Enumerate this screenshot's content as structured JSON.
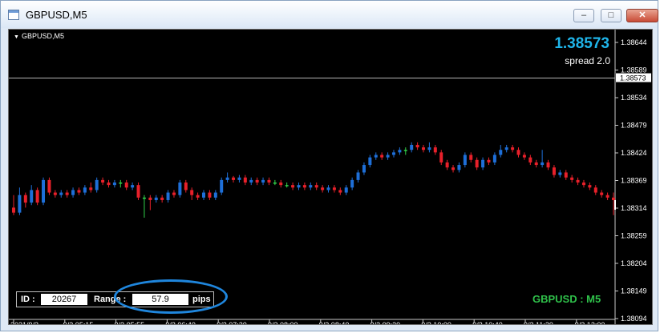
{
  "window": {
    "title": "GBPUSD,M5",
    "minimize_icon": "minimize-icon",
    "restore_icon": "restore-icon",
    "close_icon": "close-icon"
  },
  "chart": {
    "symbol_label": "GBPUSD,M5",
    "bid_price": "1.38573",
    "spread_text": "spread 2.0",
    "current_price_label": "1.38573",
    "symbol_tf_label": "GBPUSD : M5",
    "id_label": "ID :",
    "id_value": "20267",
    "range_label": "Range :",
    "range_value": "57.9",
    "pips_label": "pips",
    "colors": {
      "bull": "#1e6fd8",
      "bear": "#e8202a",
      "doji": "#32d24a",
      "axis": "#ffffff",
      "bid_line": "#b4b4b4",
      "price_text": "#1fb5ea",
      "symbol_text": "#2fc14a",
      "highlight": "#1f86dd"
    }
  },
  "chart_data": {
    "type": "candlestick",
    "y_ticks": [
      "1.38644",
      "1.38589",
      "1.38534",
      "1.38479",
      "1.38424",
      "1.38369",
      "1.38314",
      "1.38259",
      "1.38204",
      "1.38149",
      "1.38094"
    ],
    "ylim": [
      1.38094,
      1.38644
    ],
    "x_ticks": [
      "2021/9/3",
      "9/3 05:15",
      "9/3 05:55",
      "9/3 06:40",
      "9/3 07:20",
      "9/3 08:00",
      "9/3 08:40",
      "9/3 09:20",
      "9/3 10:00",
      "9/3 10:40",
      "9/3 11:20",
      "9/3 12:00"
    ],
    "current_price": 1.38573,
    "candles": [
      [
        1.38315,
        1.38305,
        1.383,
        1.3834
      ],
      [
        1.38305,
        1.3834,
        1.383,
        1.38355
      ],
      [
        1.3834,
        1.38325,
        1.38315,
        1.38345
      ],
      [
        1.38325,
        1.3835,
        1.3832,
        1.3836
      ],
      [
        1.3835,
        1.38325,
        1.3832,
        1.38355
      ],
      [
        1.38325,
        1.3837,
        1.3832,
        1.38375
      ],
      [
        1.3837,
        1.38345,
        1.3834,
        1.38375
      ],
      [
        1.38345,
        1.3834,
        1.38335,
        1.3835
      ],
      [
        1.3834,
        1.38345,
        1.38335,
        1.3835
      ],
      [
        1.38345,
        1.3834,
        1.38335,
        1.3835
      ],
      [
        1.3834,
        1.3835,
        1.38335,
        1.38355
      ],
      [
        1.3835,
        1.38345,
        1.3834,
        1.38355
      ],
      [
        1.38345,
        1.38355,
        1.3834,
        1.3836
      ],
      [
        1.38355,
        1.3835,
        1.38345,
        1.38365
      ],
      [
        1.3835,
        1.3837,
        1.38345,
        1.38375
      ],
      [
        1.3837,
        1.38365,
        1.3836,
        1.38375
      ],
      [
        1.38365,
        1.3836,
        1.38355,
        1.3837
      ],
      [
        1.3836,
        1.38365,
        1.38355,
        1.3837
      ],
      [
        1.38365,
        1.38365,
        1.38355,
        1.3837
      ],
      [
        1.38365,
        1.38355,
        1.3835,
        1.3837
      ],
      [
        1.38355,
        1.3836,
        1.3835,
        1.38365
      ],
      [
        1.3836,
        1.38335,
        1.3833,
        1.38365
      ],
      [
        1.38335,
        1.38335,
        1.38295,
        1.3834
      ],
      [
        1.38335,
        1.3833,
        1.3831,
        1.3834
      ],
      [
        1.3833,
        1.38335,
        1.38325,
        1.3834
      ],
      [
        1.38335,
        1.3833,
        1.38325,
        1.3834
      ],
      [
        1.3833,
        1.38345,
        1.38325,
        1.3835
      ],
      [
        1.38345,
        1.3834,
        1.38335,
        1.3835
      ],
      [
        1.3834,
        1.38365,
        1.38335,
        1.3837
      ],
      [
        1.38365,
        1.3835,
        1.38345,
        1.3837
      ],
      [
        1.3835,
        1.3834,
        1.3833,
        1.38355
      ],
      [
        1.3834,
        1.38335,
        1.3833,
        1.38345
      ],
      [
        1.38335,
        1.38345,
        1.3833,
        1.3835
      ],
      [
        1.38345,
        1.38335,
        1.3833,
        1.3835
      ],
      [
        1.38335,
        1.38345,
        1.3833,
        1.3835
      ],
      [
        1.38345,
        1.3837,
        1.3834,
        1.38375
      ],
      [
        1.3837,
        1.38375,
        1.38365,
        1.38385
      ],
      [
        1.38375,
        1.3837,
        1.38365,
        1.38378
      ],
      [
        1.3837,
        1.38375,
        1.38365,
        1.3838
      ],
      [
        1.38375,
        1.38365,
        1.3836,
        1.3838
      ],
      [
        1.38365,
        1.3837,
        1.3836,
        1.38375
      ],
      [
        1.3837,
        1.38365,
        1.3836,
        1.38375
      ],
      [
        1.38365,
        1.3837,
        1.3836,
        1.38375
      ],
      [
        1.3837,
        1.38365,
        1.3836,
        1.38375
      ],
      [
        1.38365,
        1.38365,
        1.3836,
        1.3837
      ],
      [
        1.38365,
        1.3836,
        1.38355,
        1.3837
      ],
      [
        1.3836,
        1.3836,
        1.38355,
        1.38365
      ],
      [
        1.3836,
        1.38355,
        1.3835,
        1.38365
      ],
      [
        1.38355,
        1.3836,
        1.3835,
        1.38365
      ],
      [
        1.3836,
        1.38355,
        1.3835,
        1.38365
      ],
      [
        1.38355,
        1.3836,
        1.3835,
        1.38365
      ],
      [
        1.3836,
        1.38355,
        1.3835,
        1.38365
      ],
      [
        1.38355,
        1.3835,
        1.38345,
        1.3836
      ],
      [
        1.3835,
        1.38355,
        1.38345,
        1.3836
      ],
      [
        1.38355,
        1.3835,
        1.38345,
        1.3836
      ],
      [
        1.3835,
        1.38345,
        1.3834,
        1.38355
      ],
      [
        1.38345,
        1.38355,
        1.3834,
        1.3836
      ],
      [
        1.38355,
        1.3837,
        1.3835,
        1.38375
      ],
      [
        1.3837,
        1.38385,
        1.38365,
        1.3839
      ],
      [
        1.38385,
        1.384,
        1.3838,
        1.38405
      ],
      [
        1.384,
        1.38415,
        1.38395,
        1.3842
      ],
      [
        1.38415,
        1.3842,
        1.3841,
        1.38425
      ],
      [
        1.3842,
        1.38415,
        1.3841,
        1.38425
      ],
      [
        1.38415,
        1.3842,
        1.3841,
        1.38425
      ],
      [
        1.3842,
        1.38425,
        1.38415,
        1.3843
      ],
      [
        1.38425,
        1.3843,
        1.3842,
        1.38435
      ],
      [
        1.3843,
        1.3843,
        1.3842,
        1.38435
      ],
      [
        1.3843,
        1.3844,
        1.38425,
        1.38445
      ],
      [
        1.3844,
        1.38435,
        1.3843,
        1.38445
      ],
      [
        1.38435,
        1.3843,
        1.38425,
        1.3844
      ],
      [
        1.3843,
        1.38435,
        1.38425,
        1.38445
      ],
      [
        1.38435,
        1.38425,
        1.3842,
        1.3844
      ],
      [
        1.38425,
        1.38405,
        1.384,
        1.3843
      ],
      [
        1.38405,
        1.38395,
        1.3839,
        1.3841
      ],
      [
        1.38395,
        1.3839,
        1.38385,
        1.384
      ],
      [
        1.3839,
        1.384,
        1.38385,
        1.38405
      ],
      [
        1.384,
        1.3842,
        1.38395,
        1.38425
      ],
      [
        1.3842,
        1.3841,
        1.38405,
        1.38425
      ],
      [
        1.3841,
        1.38395,
        1.3839,
        1.38415
      ],
      [
        1.38395,
        1.3841,
        1.3839,
        1.38415
      ],
      [
        1.3841,
        1.38405,
        1.384,
        1.38415
      ],
      [
        1.38405,
        1.3842,
        1.384,
        1.38425
      ],
      [
        1.3842,
        1.3843,
        1.38415,
        1.3844
      ],
      [
        1.3843,
        1.38435,
        1.38425,
        1.3844
      ],
      [
        1.38435,
        1.3843,
        1.38425,
        1.3844
      ],
      [
        1.3843,
        1.3842,
        1.38415,
        1.38435
      ],
      [
        1.3842,
        1.38415,
        1.3841,
        1.38425
      ],
      [
        1.38415,
        1.38405,
        1.384,
        1.3842
      ],
      [
        1.38405,
        1.384,
        1.38395,
        1.3841
      ],
      [
        1.384,
        1.38405,
        1.38395,
        1.3843
      ],
      [
        1.38405,
        1.38395,
        1.3839,
        1.3841
      ],
      [
        1.38395,
        1.3838,
        1.38375,
        1.384
      ],
      [
        1.3838,
        1.38385,
        1.38375,
        1.3839
      ],
      [
        1.38385,
        1.38375,
        1.3837,
        1.3839
      ],
      [
        1.38375,
        1.3837,
        1.38365,
        1.3838
      ],
      [
        1.3837,
        1.38365,
        1.3836,
        1.38375
      ],
      [
        1.38365,
        1.3836,
        1.38355,
        1.3837
      ],
      [
        1.3836,
        1.38355,
        1.3835,
        1.38365
      ],
      [
        1.38355,
        1.38345,
        1.3834,
        1.3836
      ],
      [
        1.38345,
        1.3834,
        1.38335,
        1.3835
      ],
      [
        1.3834,
        1.38335,
        1.3833,
        1.38345
      ],
      [
        1.38335,
        1.3833,
        1.383,
        1.38345
      ]
    ]
  }
}
